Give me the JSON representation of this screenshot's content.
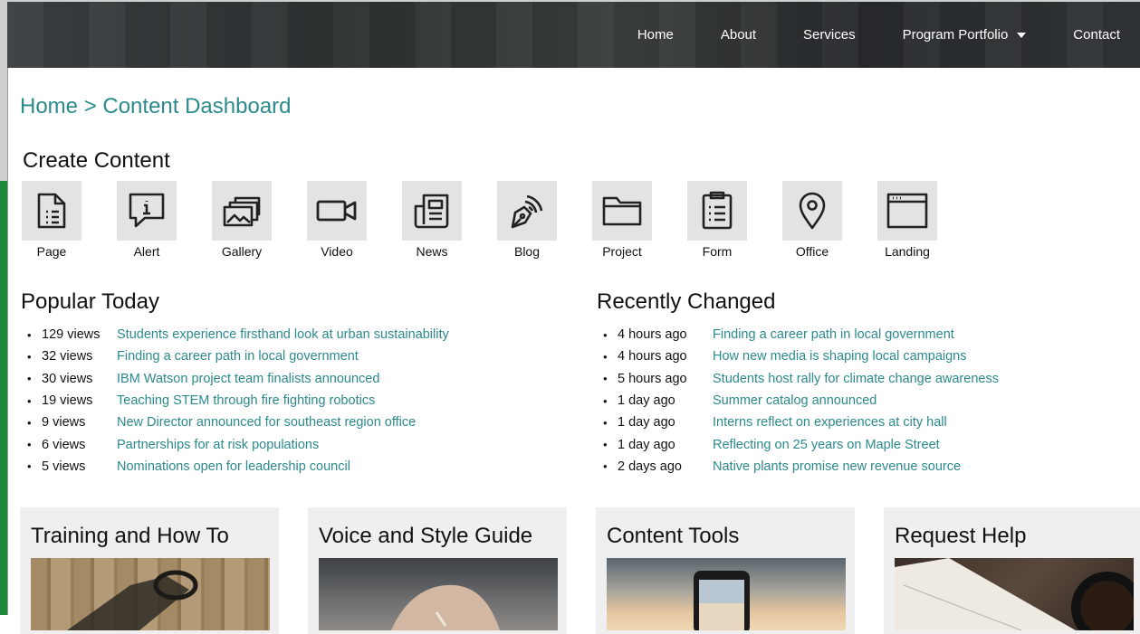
{
  "header": {
    "nav": [
      "Home",
      "About",
      "Services",
      "Program Portfolio",
      "Contact"
    ]
  },
  "breadcrumb": "Home > Content Dashboard",
  "create": {
    "title": "Create Content",
    "items": [
      {
        "label": "Page",
        "icon": "page-icon"
      },
      {
        "label": "Alert",
        "icon": "alert-icon"
      },
      {
        "label": "Gallery",
        "icon": "gallery-icon"
      },
      {
        "label": "Video",
        "icon": "video-icon"
      },
      {
        "label": "News",
        "icon": "news-icon"
      },
      {
        "label": "Blog",
        "icon": "blog-icon"
      },
      {
        "label": "Project",
        "icon": "folder-icon"
      },
      {
        "label": "Form",
        "icon": "form-icon"
      },
      {
        "label": "Office",
        "icon": "map-pin-icon"
      },
      {
        "label": "Landing",
        "icon": "browser-window-icon"
      }
    ]
  },
  "popular": {
    "title": "Popular Today",
    "items": [
      {
        "meta": "129 views",
        "title": "Students experience firsthand look at urban sustainability"
      },
      {
        "meta": "32 views",
        "title": "Finding a career path in local government"
      },
      {
        "meta": "30 views",
        "title": "IBM Watson project team finalists announced"
      },
      {
        "meta": "19 views",
        "title": "Teaching STEM through fire fighting robotics"
      },
      {
        "meta": "9 views",
        "title": "New Director announced for southeast region office"
      },
      {
        "meta": "6 views",
        "title": "Partnerships for at risk populations"
      },
      {
        "meta": "5 views",
        "title": "Nominations open for leadership council"
      }
    ]
  },
  "recent": {
    "title": "Recently Changed",
    "items": [
      {
        "meta": "4 hours ago",
        "title": "Finding a career path in local government"
      },
      {
        "meta": "4 hours ago",
        "title": "How new media is shaping local campaigns"
      },
      {
        "meta": "5 hours ago",
        "title": "Students host rally for climate change awareness"
      },
      {
        "meta": "1 day ago",
        "title": "Summer catalog announced"
      },
      {
        "meta": "1 day ago",
        "title": "Interns reflect on experiences at city hall"
      },
      {
        "meta": "1 day ago",
        "title": "Reflecting on 25 years on Maple Street"
      },
      {
        "meta": "2 days ago",
        "title": "Native plants promise new revenue source"
      }
    ]
  },
  "cards": [
    {
      "title": "Training and How To"
    },
    {
      "title": "Voice and Style Guide"
    },
    {
      "title": "Content Tools"
    },
    {
      "title": "Request Help"
    }
  ],
  "colors": {
    "link": "#2c8a8c",
    "tile_bg": "#e3e3e3",
    "card_bg": "#efefef",
    "header_bg": "#2d3132"
  }
}
